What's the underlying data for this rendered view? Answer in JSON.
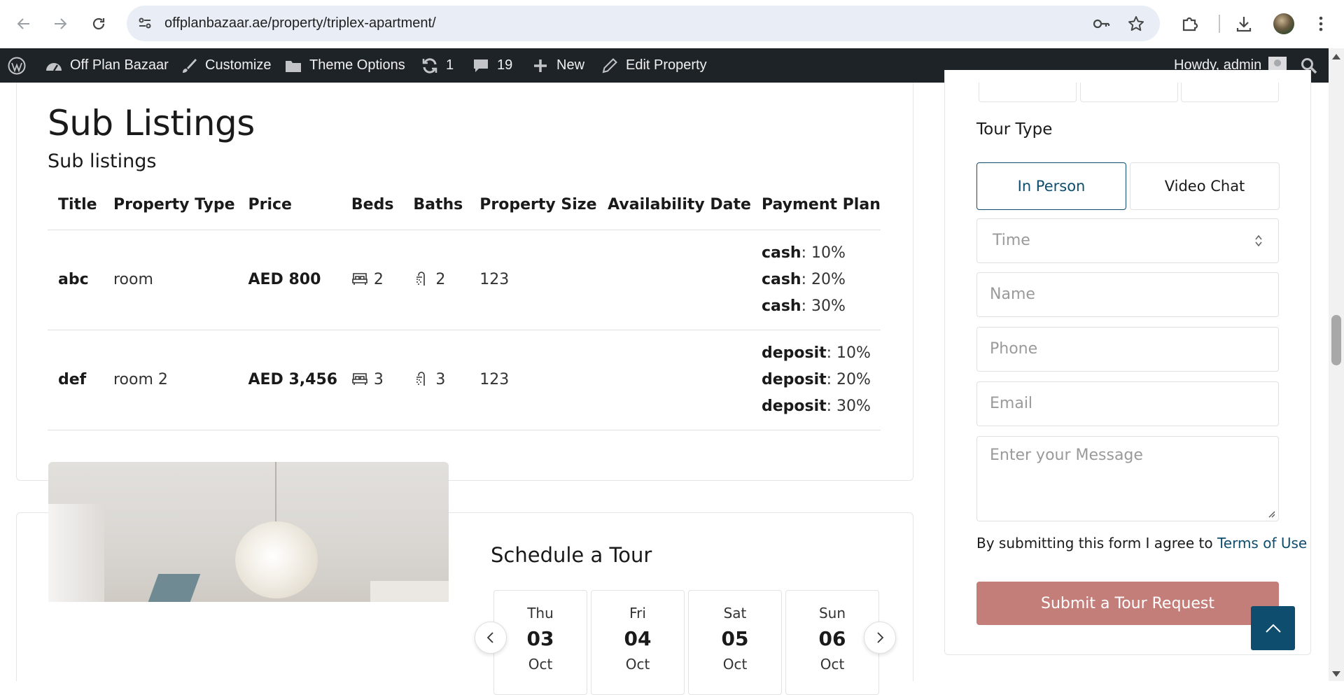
{
  "browser": {
    "url": "offplanbazaar.ae/property/triplex-apartment/"
  },
  "wp_admin_bar": {
    "site_name": "Off Plan Bazaar",
    "customize": "Customize",
    "theme_options": "Theme Options",
    "updates_count": "1",
    "comments_count": "19",
    "new": "New",
    "edit_property": "Edit Property",
    "greeting": "Howdy, admin"
  },
  "sub_listings": {
    "title": "Sub Listings",
    "subtitle": "Sub listings",
    "columns": [
      "Title",
      "Property Type",
      "Price",
      "Beds",
      "Baths",
      "Property Size",
      "Availability Date",
      "Payment Plan"
    ],
    "rows": [
      {
        "title": "abc",
        "type": "room",
        "price": "AED 800",
        "beds": "2",
        "baths": "2",
        "size": "123",
        "availability": "",
        "plan": [
          {
            "label": "cash",
            "value": ": 10%"
          },
          {
            "label": "cash",
            "value": ": 20%"
          },
          {
            "label": "cash",
            "value": ": 30%"
          }
        ]
      },
      {
        "title": "def",
        "type": "room 2",
        "price": "AED 3,456",
        "beds": "3",
        "baths": "3",
        "size": "123",
        "availability": "",
        "plan": [
          {
            "label": "deposit",
            "value": ": 10%"
          },
          {
            "label": "deposit",
            "value": ": 20%"
          },
          {
            "label": "deposit",
            "value": ": 30%"
          }
        ]
      }
    ]
  },
  "schedule": {
    "title": "Schedule a Tour",
    "days": [
      {
        "dow": "Thu",
        "num": "03",
        "mon": "Oct"
      },
      {
        "dow": "Fri",
        "num": "04",
        "mon": "Oct"
      },
      {
        "dow": "Sat",
        "num": "05",
        "mon": "Oct"
      },
      {
        "dow": "Sun",
        "num": "06",
        "mon": "Oct"
      }
    ]
  },
  "tour_form": {
    "tour_type_label": "Tour Type",
    "in_person": "In Person",
    "video_chat": "Video Chat",
    "time_placeholder": "Time",
    "name_placeholder": "Name",
    "phone_placeholder": "Phone",
    "email_placeholder": "Email",
    "message_placeholder": "Enter your Message",
    "terms_text": "By submitting this form I agree to ",
    "terms_link": "Terms of Use",
    "submit": "Submit a Tour Request"
  },
  "colors": {
    "accent": "#0e4d6e",
    "submit": "#c47e7a",
    "admin_bar": "#1d2327"
  }
}
